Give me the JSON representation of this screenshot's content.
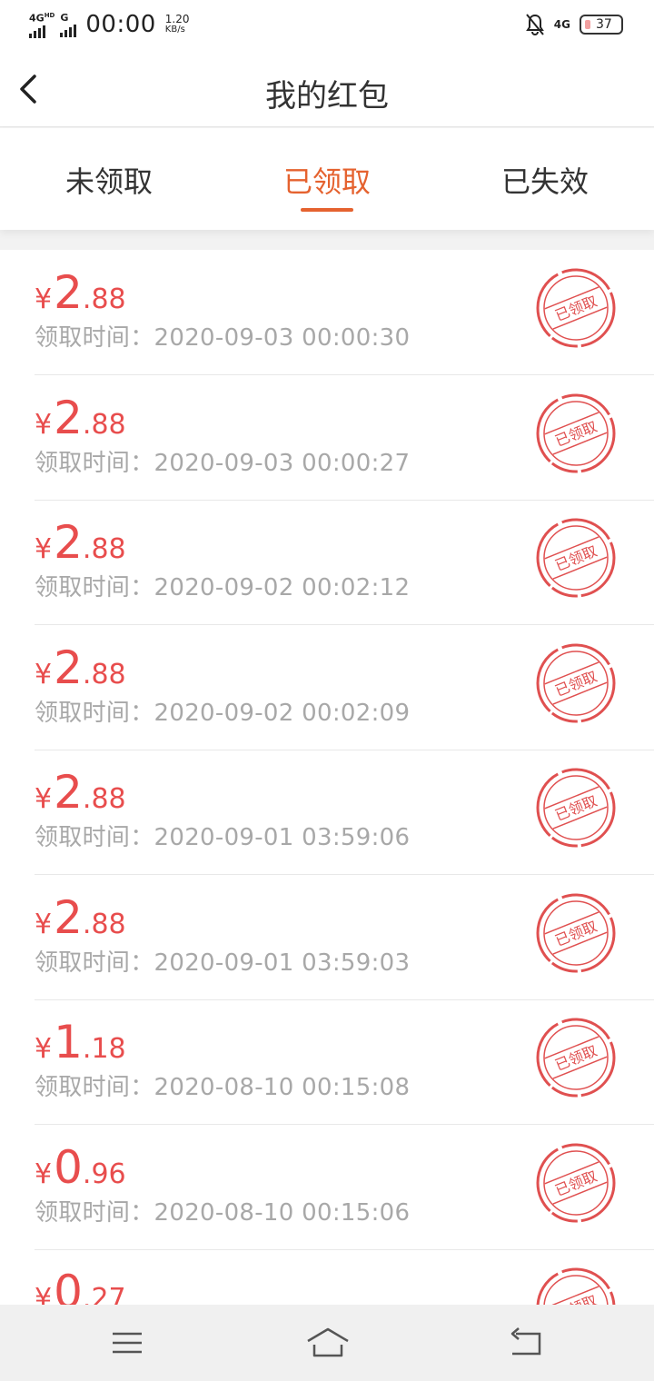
{
  "status_bar": {
    "net1": "4G",
    "net1_sup": "HD",
    "net2": "G",
    "time": "00:00",
    "speed_value": "1.20",
    "speed_unit": "KB/s",
    "net4g": "4G",
    "battery": "37"
  },
  "header": {
    "title": "我的红包"
  },
  "tabs": [
    {
      "label": "未领取",
      "active": false
    },
    {
      "label": "已领取",
      "active": true
    },
    {
      "label": "已失效",
      "active": false
    }
  ],
  "list": {
    "currency": "¥",
    "received_prefix": "领取时间：",
    "stamp_text": "已领取",
    "items": [
      {
        "int": "2",
        "dec": ".88",
        "time": "2020-09-03 00:00:30"
      },
      {
        "int": "2",
        "dec": ".88",
        "time": "2020-09-03 00:00:27"
      },
      {
        "int": "2",
        "dec": ".88",
        "time": "2020-09-02 00:02:12"
      },
      {
        "int": "2",
        "dec": ".88",
        "time": "2020-09-02 00:02:09"
      },
      {
        "int": "2",
        "dec": ".88",
        "time": "2020-09-01 03:59:06"
      },
      {
        "int": "2",
        "dec": ".88",
        "time": "2020-09-01 03:59:03"
      },
      {
        "int": "1",
        "dec": ".18",
        "time": "2020-08-10 00:15:08"
      },
      {
        "int": "0",
        "dec": ".96",
        "time": "2020-08-10 00:15:06"
      },
      {
        "int": "0",
        "dec": ".27",
        "time": ""
      }
    ]
  },
  "colors": {
    "accent": "#e5622f",
    "amount": "#e84d4d",
    "stamp": "#e05050"
  },
  "icons": {
    "back": "chevron-left-icon",
    "bell": "bell-muted-icon",
    "menu": "menu-icon",
    "home": "home-icon",
    "return": "return-icon"
  }
}
